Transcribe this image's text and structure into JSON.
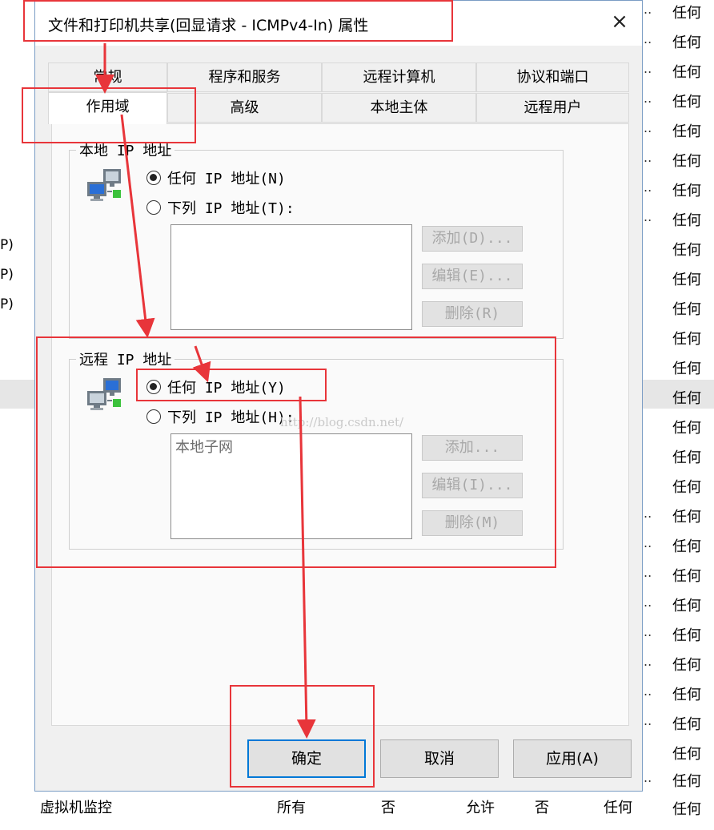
{
  "background": {
    "right_column": [
      "任何",
      "任何",
      "任何",
      "任何",
      "任何",
      "任何",
      "任何",
      "任何",
      "任何",
      "任何",
      "任何",
      "任何",
      "任何",
      "任何",
      "任何",
      "任何",
      "任何",
      "任何",
      "任何",
      "任何",
      "任何",
      "任何",
      "任何",
      "任何",
      "任何",
      "任何",
      "任何",
      "任何"
    ],
    "dots": "..",
    "left_fragments": [
      "P)",
      "P)",
      "P)"
    ],
    "bottom_row": {
      "name": "虚拟机监控",
      "profile": "所有",
      "enabled": "否",
      "action": "允许",
      "override": "否",
      "program": "任何",
      "local": "任何"
    }
  },
  "dialog": {
    "title": "文件和打印机共享(回显请求 - ICMPv4-In) 属性",
    "close_glyph": "×",
    "tabs_row1": [
      "常规",
      "程序和服务",
      "远程计算机",
      "协议和端口"
    ],
    "tabs_row2": [
      "作用域",
      "高级",
      "本地主体",
      "远程用户"
    ],
    "active_tab": "作用域",
    "local": {
      "title": "本地 IP 地址",
      "option_any": "任何 IP 地址(N)",
      "option_list": "下列 IP 地址(T):",
      "selected": "any",
      "buttons": [
        "添加(D)...",
        "编辑(E)...",
        "删除(R)"
      ]
    },
    "remote": {
      "title": "远程 IP 地址",
      "option_any": "任何 IP 地址(Y)",
      "option_list": "下列 IP 地址(H):",
      "selected": "any",
      "list_items": [
        "本地子网"
      ],
      "buttons": [
        "添加...",
        "编辑(I)...",
        "删除(M)"
      ]
    },
    "footer": {
      "ok": "确定",
      "cancel": "取消",
      "apply": "应用(A)"
    }
  },
  "watermark": "http://blog.csdn.net/",
  "colors": {
    "annotation_red": "#e8353a",
    "accent_blue": "#0078d7"
  }
}
